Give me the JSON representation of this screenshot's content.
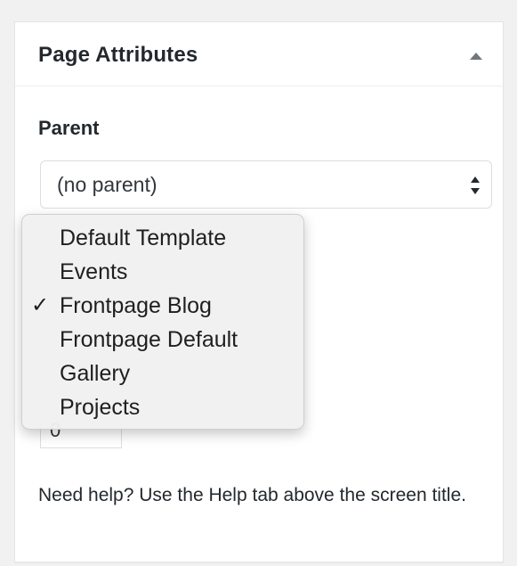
{
  "panel": {
    "title": "Page Attributes",
    "collapse_icon": "triangle-up-icon"
  },
  "parent": {
    "label": "Parent",
    "selected": "(no parent)",
    "arrow_icon": "up-down-arrows-icon"
  },
  "template_menu": {
    "items": [
      {
        "label": "Default Template",
        "checked": false
      },
      {
        "label": "Events",
        "checked": false
      },
      {
        "label": "Frontpage Blog",
        "checked": true
      },
      {
        "label": "Frontpage Default",
        "checked": false
      },
      {
        "label": "Gallery",
        "checked": false
      },
      {
        "label": "Projects",
        "checked": false
      }
    ],
    "check_glyph": "✓"
  },
  "order": {
    "value": "0"
  },
  "help": {
    "text": "Need help? Use the Help tab above the screen title."
  },
  "colors": {
    "background": "#f1f1f1",
    "panel": "#ffffff",
    "border": "#e5e5e5",
    "text": "#23282d",
    "menu_bg": "#f0f0f0"
  }
}
